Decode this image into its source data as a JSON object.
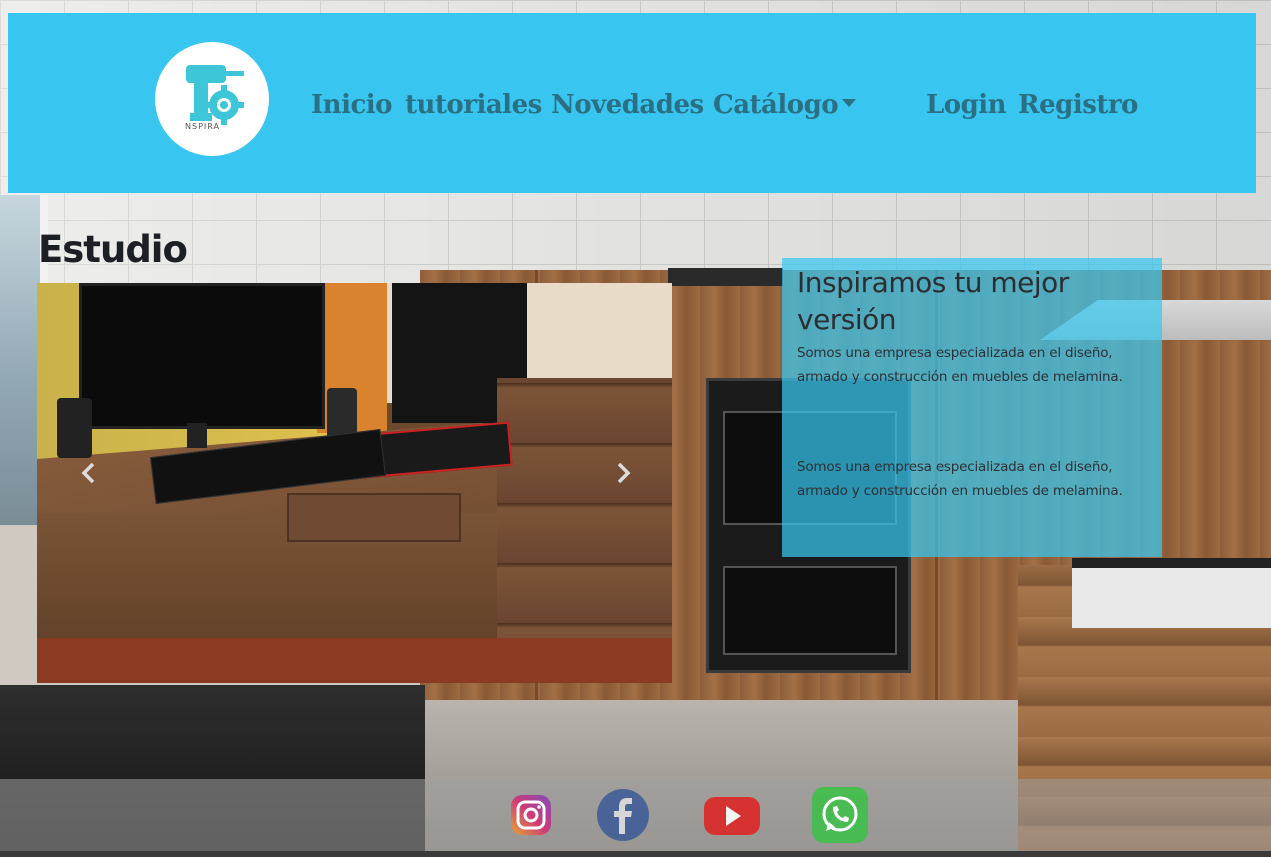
{
  "header": {
    "logo_text": "NSPIRA",
    "nav": {
      "inicio": "Inicio",
      "tutoriales": "tutoriales",
      "novedades": "Novedades",
      "catalogo": "Catálogo",
      "login": "Login",
      "registro": "Registro"
    }
  },
  "main": {
    "title": "Estudio",
    "carousel": {
      "prev_icon": "chevron-left-icon",
      "next_icon": "chevron-right-icon"
    },
    "info": {
      "heading": "Inspiramos tu mejor versión",
      "paragraph1": "Somos una empresa especializada en el diseño, armado y construcción en muebles de melamina.",
      "paragraph2": "Somos una empresa especializada en el diseño, armado y construcción en muebles de melamina."
    }
  },
  "footer": {
    "social": [
      "instagram-icon",
      "facebook-icon",
      "youtube-icon",
      "whatsapp-icon"
    ]
  },
  "colors": {
    "header_bg": "#38c6f0",
    "nav_text": "#2a6f84",
    "info_box_bg": "rgba(56,198,240,0.72)"
  }
}
